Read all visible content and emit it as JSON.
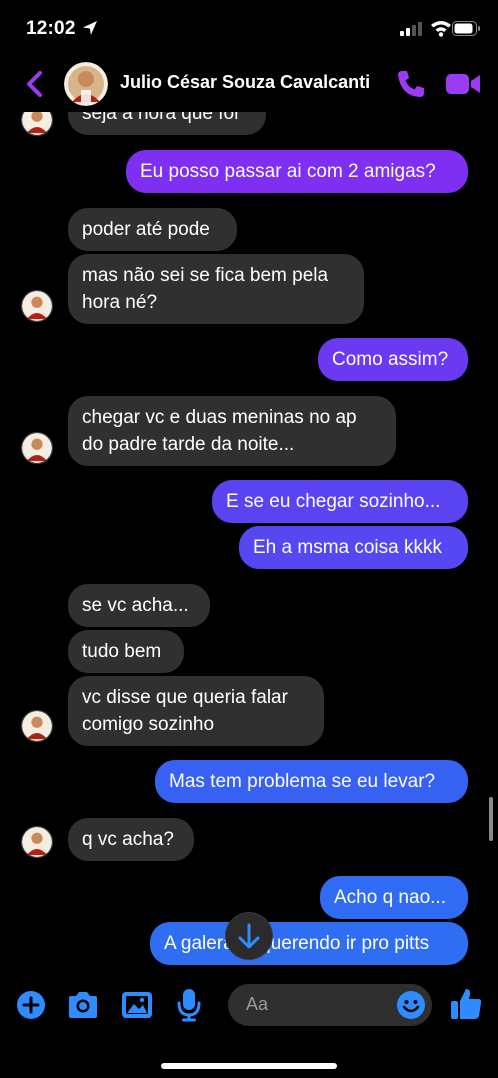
{
  "status_bar": {
    "time": "12:02"
  },
  "header": {
    "contact_name": "Julio César Souza Cavalcanti"
  },
  "colors": {
    "accent": "#9b3cf4",
    "incoming": "#303030",
    "out_purple": "#7b2ff0",
    "out_blue": "#2f6bf3"
  },
  "messages": [
    {
      "side": "in",
      "text": "seja a hora que for"
    },
    {
      "side": "out",
      "text": "Eu posso passar ai com 2 amigas?"
    },
    {
      "side": "in",
      "text": "poder até pode"
    },
    {
      "side": "in",
      "text": "mas não sei se fica bem pela hora né?"
    },
    {
      "side": "out",
      "text": "Como assim?"
    },
    {
      "side": "in",
      "text": "chegar vc e duas meninas no ap do padre tarde da noite..."
    },
    {
      "side": "out",
      "text": "E se eu chegar sozinho..."
    },
    {
      "side": "out",
      "text": "Eh a msma coisa kkkk"
    },
    {
      "side": "in",
      "text": "se vc acha..."
    },
    {
      "side": "in",
      "text": "tudo bem"
    },
    {
      "side": "in",
      "text": "vc disse que queria falar comigo sozinho"
    },
    {
      "side": "out",
      "text": "Mas tem problema se eu levar?"
    },
    {
      "side": "in",
      "text": "q vc acha?"
    },
    {
      "side": "out",
      "text": "Acho q nao..."
    },
    {
      "side": "out",
      "text": "A galera ta querendo ir pro pitts"
    }
  ],
  "composer": {
    "placeholder": "Aa"
  },
  "icons": {
    "back": "chevron-left-icon",
    "call": "phone-icon",
    "video": "video-camera-icon",
    "add": "plus-circle-icon",
    "camera": "camera-icon",
    "gallery": "image-icon",
    "mic": "microphone-icon",
    "emoji": "emoji-icon",
    "like": "thumbs-up-icon",
    "jump": "arrow-down-icon"
  }
}
